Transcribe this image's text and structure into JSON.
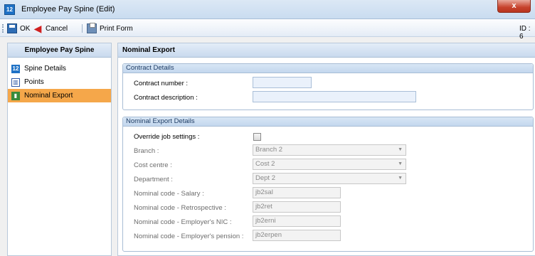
{
  "window": {
    "title": "Employee Pay Spine (Edit)",
    "icon_text": "12",
    "close_glyph": "x"
  },
  "toolbar": {
    "ok_label": "OK",
    "cancel_label": "Cancel",
    "print_label": "Print Form",
    "id_label": "ID : 6"
  },
  "nav": {
    "header": "Employee Pay Spine",
    "items": [
      {
        "label": "Spine Details",
        "icon": "spine-details-icon",
        "active": false
      },
      {
        "label": "Points",
        "icon": "points-icon",
        "active": false
      },
      {
        "label": "Nominal Export",
        "icon": "nominal-export-icon",
        "active": true
      }
    ]
  },
  "main": {
    "header": "Nominal Export",
    "contract": {
      "title": "Contract Details",
      "number_label": "Contract number :",
      "number_value": "",
      "description_label": "Contract description :",
      "description_value": ""
    },
    "export": {
      "title": "Nominal Export Details",
      "override_label": "Override job settings :",
      "override_checked": false,
      "branch_label": "Branch :",
      "branch_value": "Branch 2",
      "cost_centre_label": "Cost centre :",
      "cost_centre_value": "Cost 2",
      "department_label": "Department :",
      "department_value": "Dept 2",
      "salary_label": "Nominal code - Salary :",
      "salary_value": "jb2sal",
      "retro_label": "Nominal code - Retrospective :",
      "retro_value": "jb2ret",
      "nic_label": "Nominal code - Employer's NIC :",
      "nic_value": "jb2erni",
      "pension_label": "Nominal code - Employer's pension :",
      "pension_value": "jb2erpen"
    }
  },
  "colors": {
    "active_nav": "#f5a74a",
    "header_blue": "#c9daee",
    "close_red": "#c7432d"
  }
}
